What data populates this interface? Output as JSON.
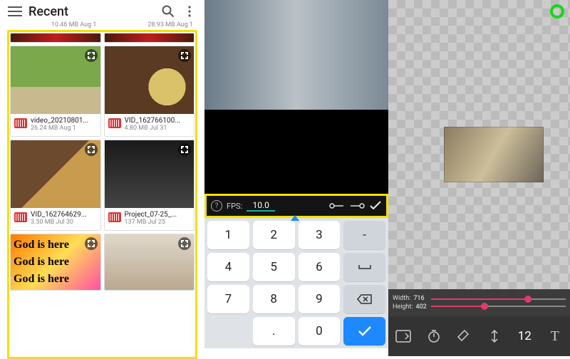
{
  "panel1": {
    "title": "Recent",
    "tinytop": [
      {
        "size": "10.46 MB",
        "date": "Aug 1"
      },
      {
        "size": "28.93 MB",
        "date": "Aug 1"
      }
    ],
    "items": [
      {
        "name": "video_20210801...",
        "size": "26.24 MB",
        "date": "Aug 1",
        "thumbClass": "th-path"
      },
      {
        "name": "VID_162766100...",
        "size": "4.80 MB",
        "date": "Jul 31",
        "thumbClass": "th-food1"
      },
      {
        "name": "VID_162764629...",
        "size": "3.50 MB",
        "date": "Jul 30",
        "thumbClass": "th-food2"
      },
      {
        "name": "Project_07-25_...",
        "size": "137 MB",
        "date": "Jul 25",
        "thumbClass": "th-guitar"
      }
    ],
    "godText": "God is here"
  },
  "panel2": {
    "fps": {
      "label": "FPS:",
      "value": "10.0"
    },
    "keys": [
      [
        "1",
        "2",
        "3",
        "-"
      ],
      [
        "4",
        "5",
        "6",
        "␣"
      ],
      [
        "7",
        "8",
        "9",
        "⌫"
      ],
      [
        "",
        ".",
        "0",
        "✓"
      ]
    ]
  },
  "panel3": {
    "width": {
      "label": "Width:",
      "value": "716",
      "pct": 72
    },
    "height": {
      "label": "Height:",
      "value": "402",
      "pct": 40
    },
    "zoom": "12"
  }
}
